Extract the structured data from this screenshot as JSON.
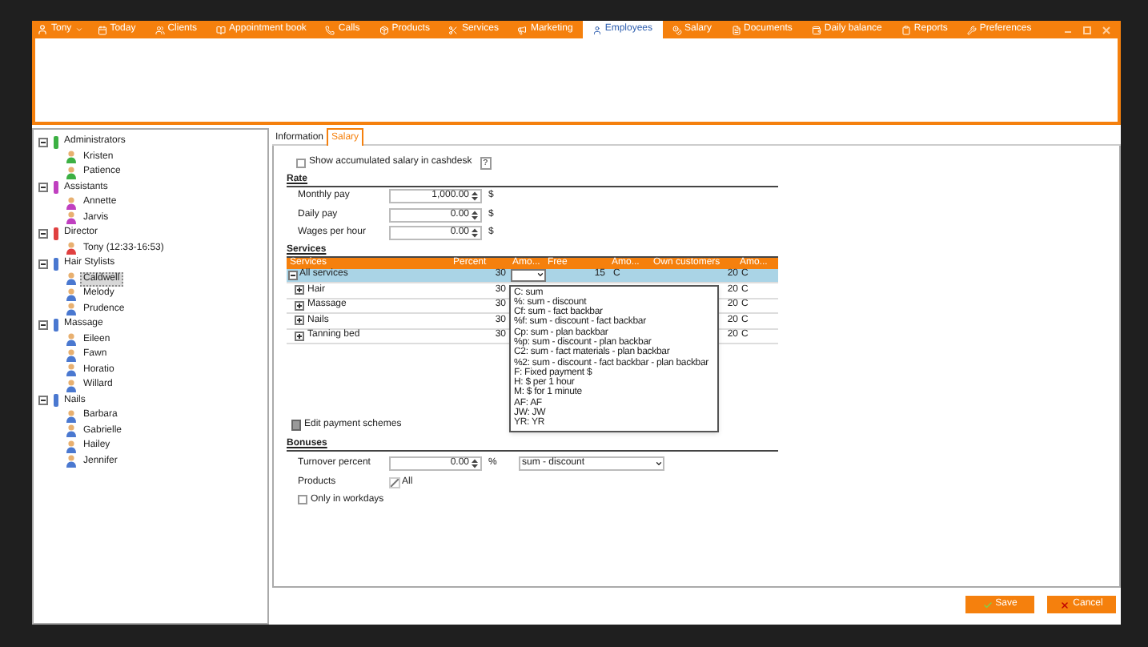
{
  "nav": {
    "user": "Tony",
    "items": [
      {
        "label": "Today",
        "selected": false
      },
      {
        "label": "Clients",
        "selected": false
      },
      {
        "label": "Appointment book",
        "selected": false
      },
      {
        "label": "Calls",
        "selected": false
      },
      {
        "label": "Products",
        "selected": false
      },
      {
        "label": "Services",
        "selected": false
      },
      {
        "label": "Marketing",
        "selected": false
      },
      {
        "label": "Employees",
        "selected": true
      },
      {
        "label": "Salary",
        "selected": false
      },
      {
        "label": "Documents",
        "selected": false
      },
      {
        "label": "Daily balance",
        "selected": false
      },
      {
        "label": "Reports",
        "selected": false
      },
      {
        "label": "Preferences",
        "selected": false
      }
    ]
  },
  "tree": [
    {
      "label": "Administrators",
      "color": "#3cb043",
      "expanded": true,
      "children": [
        {
          "label": "Kristen",
          "selected": false
        },
        {
          "label": "Patience",
          "selected": false
        }
      ]
    },
    {
      "label": "Assistants",
      "color": "#c040c0",
      "expanded": true,
      "children": [
        {
          "label": "Annette",
          "selected": false
        },
        {
          "label": "Jarvis",
          "selected": false
        }
      ]
    },
    {
      "label": "Director",
      "color": "#e04040",
      "expanded": true,
      "children": [
        {
          "label": "Tony (12:33-16:53)",
          "selected": false
        }
      ]
    },
    {
      "label": "Hair Stylists",
      "color": "#4a78d0",
      "expanded": true,
      "children": [
        {
          "label": "Caldwell",
          "selected": true
        },
        {
          "label": "Melody",
          "selected": false
        },
        {
          "label": "Prudence",
          "selected": false
        }
      ]
    },
    {
      "label": "Massage",
      "color": "#4a78d0",
      "expanded": true,
      "children": [
        {
          "label": "Eileen",
          "selected": false
        },
        {
          "label": "Fawn",
          "selected": false
        },
        {
          "label": "Horatio",
          "selected": false
        },
        {
          "label": "Willard",
          "selected": false
        }
      ]
    },
    {
      "label": "Nails",
      "color": "#4a78d0",
      "expanded": true,
      "children": [
        {
          "label": "Barbara",
          "selected": false
        },
        {
          "label": "Gabrielle",
          "selected": false
        },
        {
          "label": "Hailey",
          "selected": false
        },
        {
          "label": "Jennifer",
          "selected": false
        }
      ]
    }
  ],
  "tabs": [
    {
      "label": "Information",
      "selected": false
    },
    {
      "label": "Salary",
      "selected": true
    }
  ],
  "show_accumulated": {
    "label": "Show accumulated salary in cashdesk",
    "checked": false,
    "help": "?"
  },
  "rate": {
    "title": "Rate",
    "rows": [
      {
        "label": "Monthly pay",
        "value": "1,000.00",
        "unit": "$"
      },
      {
        "label": "Daily pay",
        "value": "0.00",
        "unit": "$"
      },
      {
        "label": "Wages per hour",
        "value": "0.00",
        "unit": "$"
      }
    ]
  },
  "services": {
    "title": "Services",
    "columns": [
      "Services",
      "Percent",
      "Amo...",
      "Free",
      "Amo...",
      "Own customers",
      "Amo..."
    ],
    "rows": [
      {
        "name": "All services",
        "expanded": true,
        "selected": true,
        "percent": "30",
        "free": "15",
        "free_amount": "C",
        "own": "20",
        "own_amount": "C"
      },
      {
        "name": "Hair",
        "expanded": false,
        "selected": false,
        "percent": "30",
        "own": "20",
        "own_amount": "C"
      },
      {
        "name": "Massage",
        "expanded": false,
        "selected": false,
        "percent": "30",
        "own": "20",
        "own_amount": "C"
      },
      {
        "name": "Nails",
        "expanded": false,
        "selected": false,
        "percent": "30",
        "own": "20",
        "own_amount": "C"
      },
      {
        "name": "Tanning bed",
        "expanded": false,
        "selected": false,
        "percent": "30",
        "own": "20",
        "own_amount": "C"
      }
    ],
    "dropdown_options": [
      "C: sum",
      "%: sum - discount",
      "Cf: sum - fact backbar",
      "%f: sum - discount - fact backbar",
      "Cp: sum - plan backbar",
      "%p: sum - discount - plan backbar",
      "C2: sum - fact materials - plan backbar",
      "%2: sum - discount - fact backbar - plan backbar",
      "F: Fixed payment $",
      "H: $ per 1 hour",
      "M: $ for 1 minute",
      "AF: AF",
      "JW: JW",
      "YR: YR"
    ],
    "edit_link": "Edit payment schemes"
  },
  "bonuses": {
    "title": "Bonuses",
    "turnover": {
      "label": "Turnover percent",
      "value": "0.00",
      "unit": "%",
      "scheme": "sum - discount"
    },
    "products": {
      "label": "Products",
      "value": "All"
    },
    "workdays": {
      "label": "Only in workdays",
      "checked": false
    }
  },
  "buttons": [
    {
      "label": "Save",
      "kind": "save"
    },
    {
      "label": "Cancel",
      "kind": "cancel"
    }
  ]
}
